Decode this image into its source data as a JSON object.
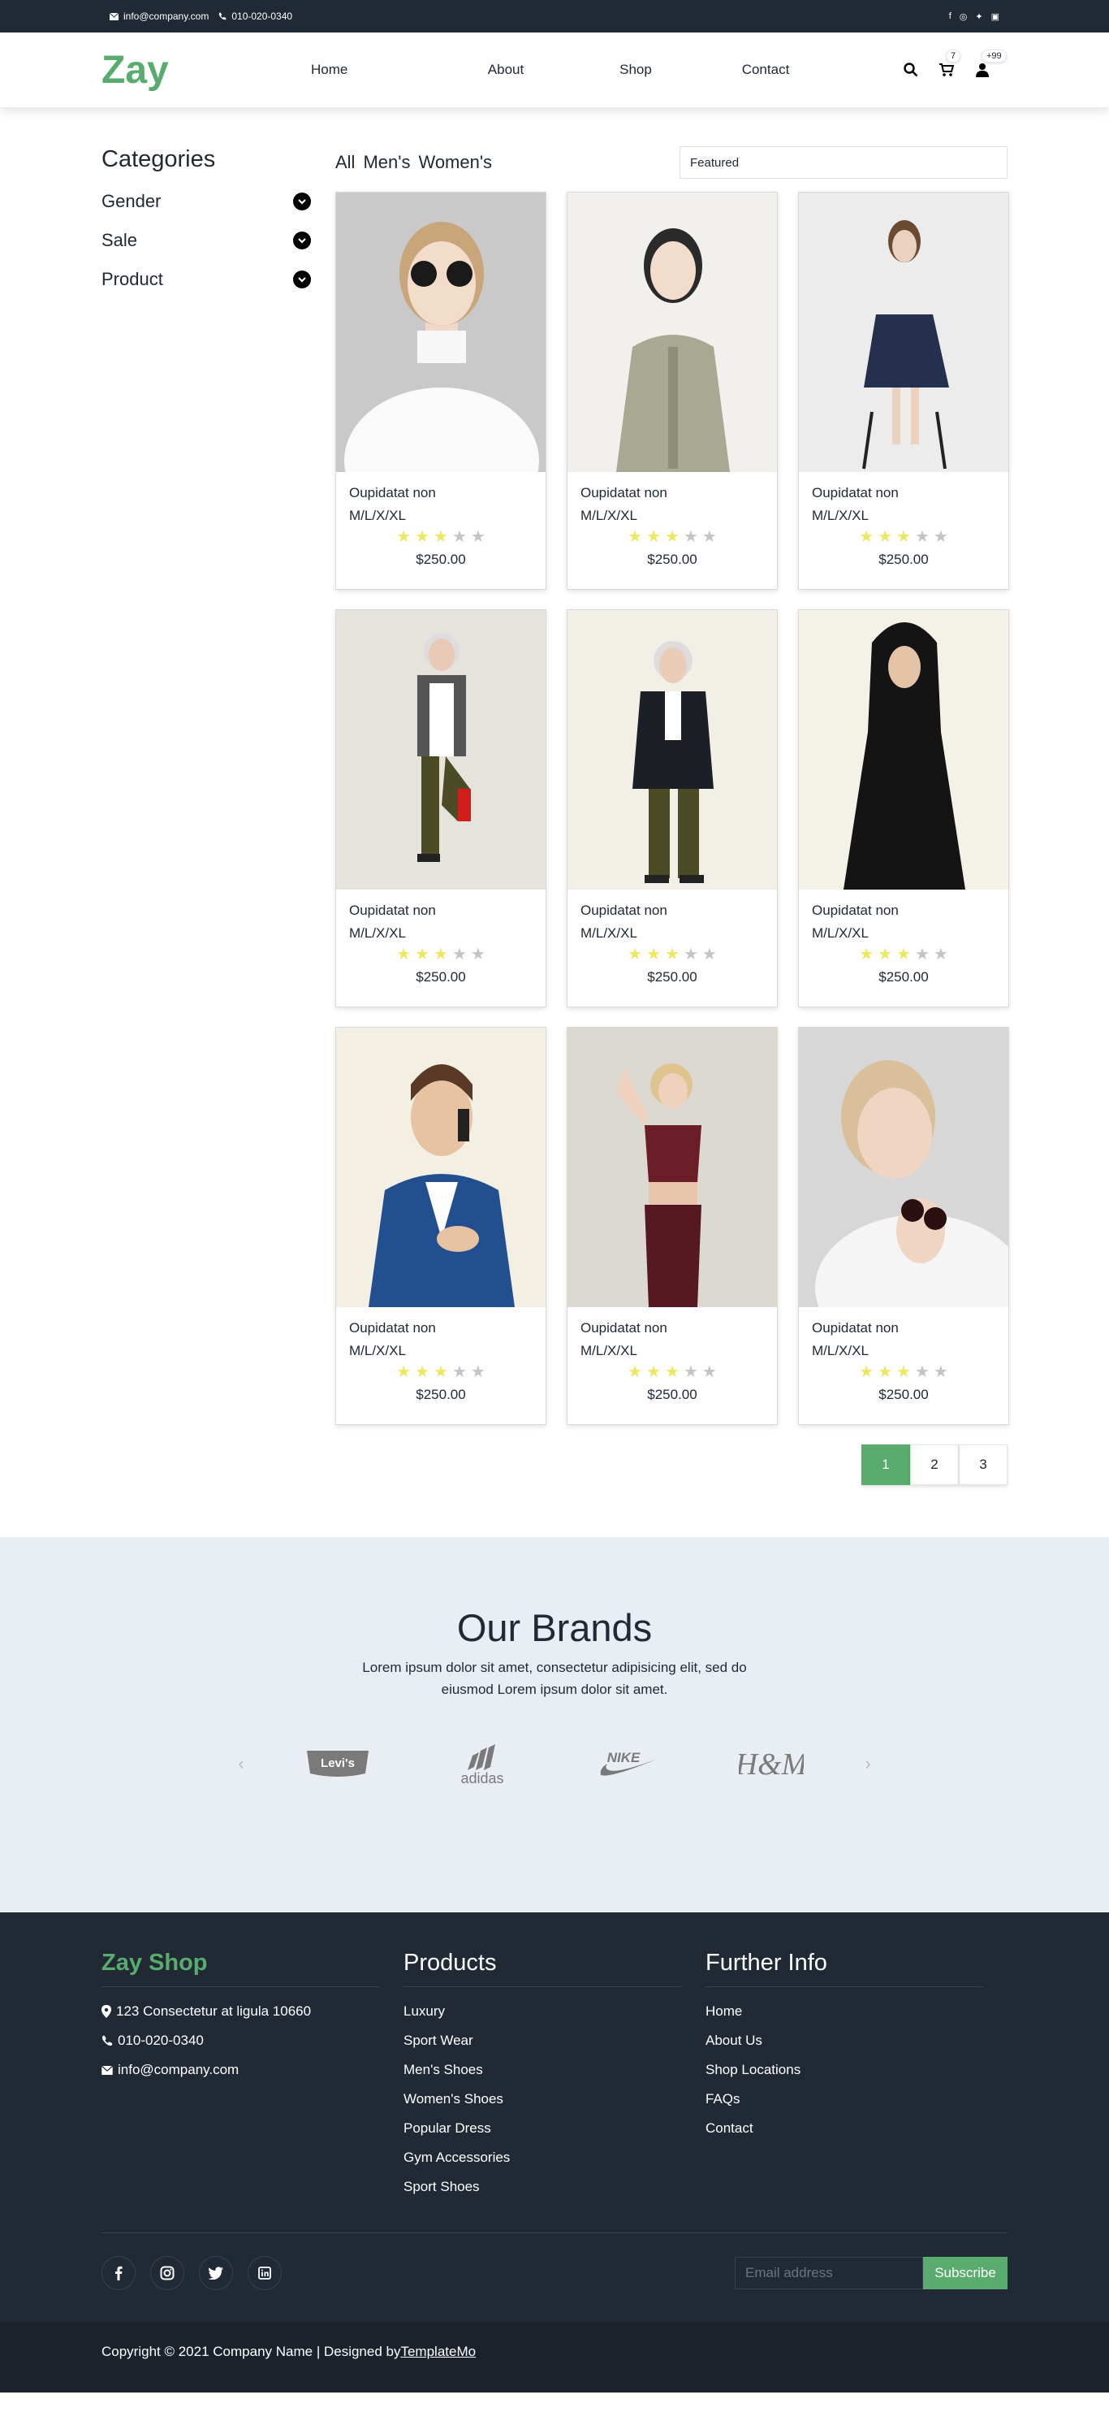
{
  "topbar": {
    "email": "info@company.com",
    "phone": "010-020-0340",
    "socials": [
      "facebook-icon",
      "instagram-icon",
      "twitter-icon",
      "linkedin-icon"
    ]
  },
  "nav": {
    "logo": "Zay",
    "items": [
      "Home",
      "About",
      "Shop",
      "Contact"
    ],
    "cart_count": "7",
    "user_count": "+99"
  },
  "sidebar": {
    "title": "Categories",
    "items": [
      "Gender",
      "Sale",
      "Product"
    ]
  },
  "filters": {
    "tabs": [
      "All",
      "Men's",
      "Women's"
    ],
    "sort_value": "Featured"
  },
  "products": [
    {
      "title": "Oupidatat non",
      "sizes": "M/L/X/XL",
      "rating": 3,
      "price": "$250.00"
    },
    {
      "title": "Oupidatat non",
      "sizes": "M/L/X/XL",
      "rating": 3,
      "price": "$250.00"
    },
    {
      "title": "Oupidatat non",
      "sizes": "M/L/X/XL",
      "rating": 3,
      "price": "$250.00"
    },
    {
      "title": "Oupidatat non",
      "sizes": "M/L/X/XL",
      "rating": 3,
      "price": "$250.00"
    },
    {
      "title": "Oupidatat non",
      "sizes": "M/L/X/XL",
      "rating": 3,
      "price": "$250.00"
    },
    {
      "title": "Oupidatat non",
      "sizes": "M/L/X/XL",
      "rating": 3,
      "price": "$250.00"
    },
    {
      "title": "Oupidatat non",
      "sizes": "M/L/X/XL",
      "rating": 3,
      "price": "$250.00"
    },
    {
      "title": "Oupidatat non",
      "sizes": "M/L/X/XL",
      "rating": 3,
      "price": "$250.00"
    },
    {
      "title": "Oupidatat non",
      "sizes": "M/L/X/XL",
      "rating": 3,
      "price": "$250.00"
    }
  ],
  "pagination": [
    "1",
    "2",
    "3"
  ],
  "brands": {
    "title": "Our Brands",
    "text": "Lorem ipsum dolor sit amet, consectetur adipisicing elit, sed do eiusmod Lorem ipsum dolor sit amet.",
    "logos": [
      "Levi's",
      "adidas",
      "NIKE",
      "H&M"
    ]
  },
  "footer": {
    "col1_title": "Zay Shop",
    "address": "123 Consectetur at ligula 10660",
    "phone": "010-020-0340",
    "email": "info@company.com",
    "col2_title": "Products",
    "products": [
      "Luxury",
      "Sport Wear",
      "Men's Shoes",
      "Women's Shoes",
      "Popular Dress",
      "Gym Accessories",
      "Sport Shoes"
    ],
    "col3_title": "Further Info",
    "info": [
      "Home",
      "About Us",
      "Shop Locations",
      "FAQs",
      "Contact"
    ],
    "email_placeholder": "Email address",
    "subscribe": "Subscribe",
    "copyright": "Copyright © 2021 Company Name | Designed by ",
    "designer": "TemplateMo"
  },
  "colors": {
    "accent": "#59ab6e",
    "dark": "#212934",
    "star_on": "#ede861",
    "star_off": "#c4c4c4"
  }
}
